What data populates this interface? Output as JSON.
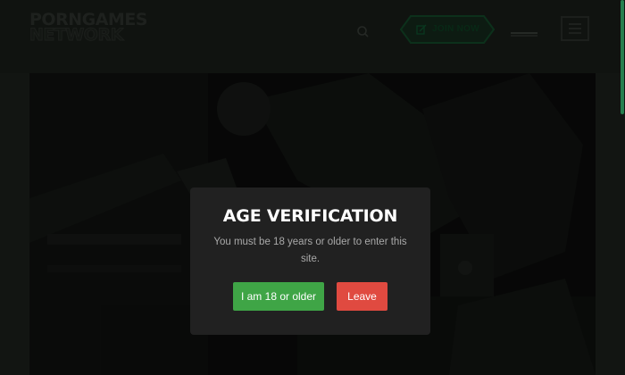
{
  "header": {
    "logo_line1": "PORNGAMES",
    "logo_line2": "NETWORK",
    "join_label": "JOIN NOW",
    "icons": {
      "search": "search-icon",
      "join": "edit-icon",
      "menu": "hamburger-menu-icon"
    }
  },
  "modal": {
    "title": "AGE VERIFICATION",
    "message": "You must be 18 years or older to enter this site.",
    "confirm_label": "I am 18 or older",
    "leave_label": "Leave"
  },
  "colors": {
    "accent": "#3cc47a",
    "confirm": "#3fa546",
    "leave": "#e04a40",
    "modal_bg": "#212121"
  }
}
